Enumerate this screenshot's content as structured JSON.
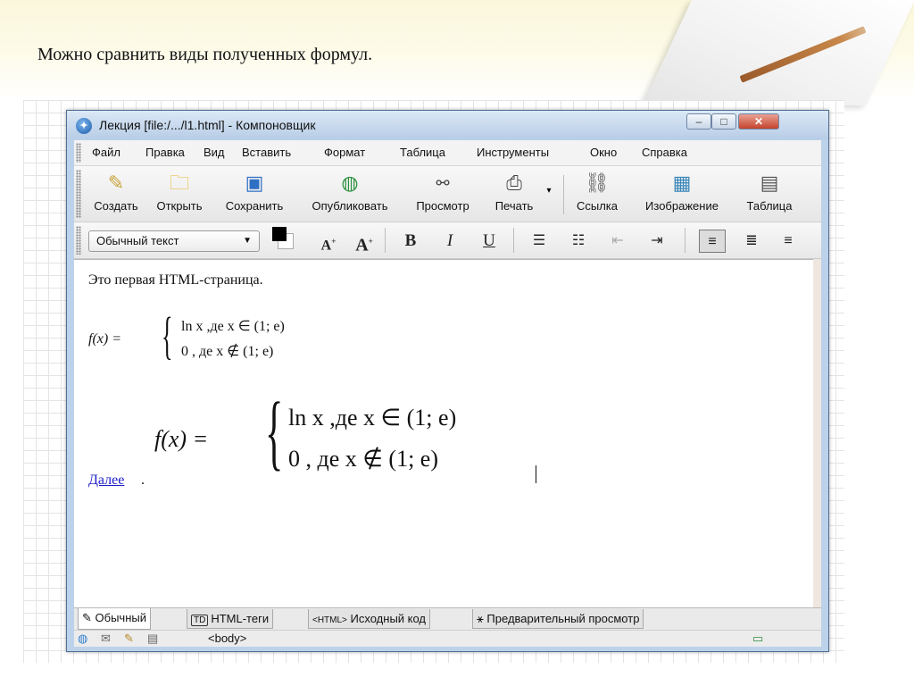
{
  "slide": {
    "title": "Можно сравнить виды полученных формул."
  },
  "window": {
    "title": "Лекция [file:/.../l1.html] - Компоновщик",
    "buttons": {
      "minimize": "–",
      "maximize": "□",
      "close": "✕"
    }
  },
  "menu": [
    "Файл",
    "Правка",
    "Вид",
    "Вставить",
    "Формат",
    "Таблица",
    "Инструменты",
    "Окно",
    "Справка"
  ],
  "toolbar": {
    "buttons": [
      {
        "label": "Создать",
        "icon": "new-page-icon"
      },
      {
        "label": "Открыть",
        "icon": "folder-icon"
      },
      {
        "label": "Сохранить",
        "icon": "save-icon"
      },
      {
        "label": "Опубликовать",
        "icon": "publish-globe-icon"
      },
      {
        "label": "Просмотр",
        "icon": "glasses-icon"
      },
      {
        "label": "Печать",
        "icon": "printer-icon"
      },
      {
        "label": "Ссылка",
        "icon": "link-chain-icon"
      },
      {
        "label": "Изображение",
        "icon": "image-icon"
      },
      {
        "label": "Таблица",
        "icon": "table-icon"
      }
    ]
  },
  "format_bar": {
    "paragraph_style": "Обычный текст",
    "bold": "B",
    "italic": "I",
    "underline": "U"
  },
  "document": {
    "intro": "Это первая HTML-страница.",
    "formula_lhs": "f(x) =",
    "case1": "ln  x  ,де   x ∈ (1;  e)",
    "case2": "0  , де   x ∉ (1;  e)",
    "link_text": "Далее",
    "link_suffix": "."
  },
  "tabs": [
    "Обычный",
    "HTML-теги",
    "Исходный код",
    "Предварительный просмотр"
  ],
  "tab_icons": {
    "html_tags": "TD",
    "source": "<HTML>"
  },
  "status": {
    "tag_path": "<body>"
  }
}
